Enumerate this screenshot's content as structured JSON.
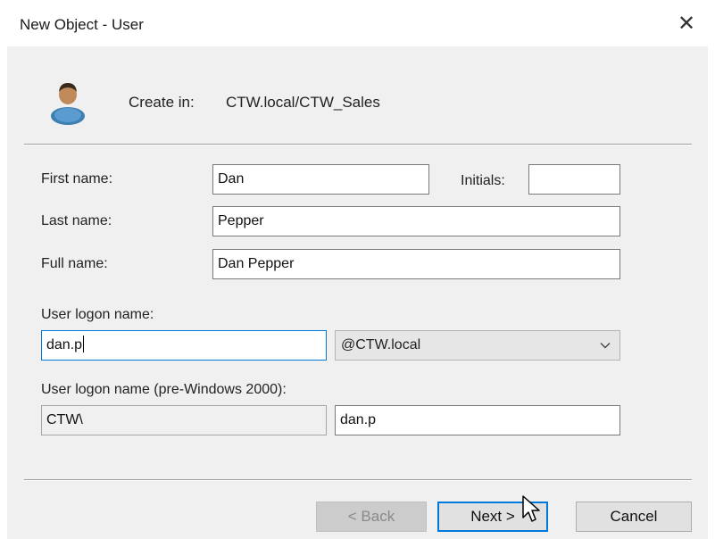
{
  "window": {
    "title": "New Object - User",
    "close_glyph": "✕"
  },
  "header": {
    "icon": "user-icon",
    "create_in_label": "Create in:",
    "create_in_value": "CTW.local/CTW_Sales"
  },
  "form": {
    "first_name_label": "First name:",
    "first_name_value": "Dan",
    "initials_label": "Initials:",
    "initials_value": "",
    "last_name_label": "Last name:",
    "last_name_value": "Pepper",
    "full_name_label": "Full name:",
    "full_name_value": "Dan Pepper",
    "logon_label": "User logon name:",
    "logon_value": "dan.p",
    "domain_selected": "@CTW.local",
    "prewin_label": "User logon name (pre-Windows 2000):",
    "prewin_domain": "CTW\\",
    "prewin_value": "dan.p"
  },
  "buttons": {
    "back": "< Back",
    "next": "Next >",
    "cancel": "Cancel"
  },
  "colors": {
    "focus": "#0078d7",
    "dialog_bg": "#f0f0f0"
  }
}
